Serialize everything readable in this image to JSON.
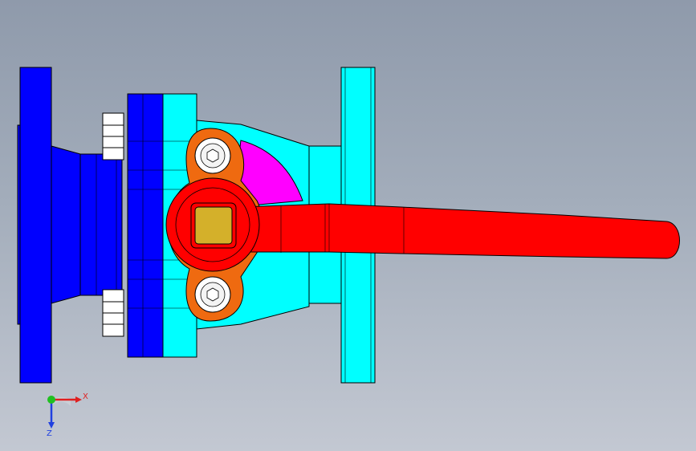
{
  "viewport": {
    "colors": {
      "left_flange": "#0000ff",
      "body_outline": "#000000",
      "right_flange": "#00ffff",
      "valve_body": "#00ffff",
      "lever": "#ff0000",
      "stop_plate": "#ef6a10",
      "stem_square": "#d4b02a",
      "position_indicator": "#ff00ff",
      "bolt": "#ffffff"
    }
  },
  "triad": {
    "x_label": "X",
    "z_label": "Z",
    "x_color": "#e02020",
    "y_color": "#20c020",
    "z_color": "#2040e0"
  }
}
